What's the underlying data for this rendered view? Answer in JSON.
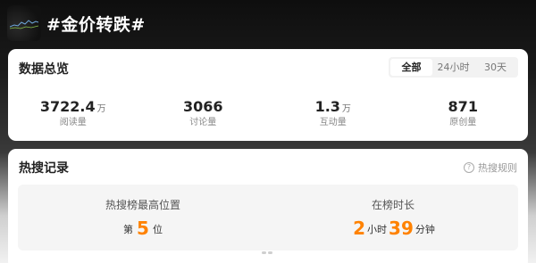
{
  "topic": {
    "title": "#金价转跌#"
  },
  "overview": {
    "title": "数据总览",
    "tabs": [
      {
        "label": "全部",
        "active": true
      },
      {
        "label": "24小时",
        "active": false
      },
      {
        "label": "30天",
        "active": false
      }
    ],
    "stats": [
      {
        "value": "3722.4",
        "unit": "万",
        "label": "阅读量"
      },
      {
        "value": "3066",
        "unit": "",
        "label": "讨论量"
      },
      {
        "value": "1.3",
        "unit": "万",
        "label": "互动量"
      },
      {
        "value": "871",
        "unit": "",
        "label": "原创量"
      }
    ]
  },
  "hot_record": {
    "title": "热搜记录",
    "rules_label": "热搜规则",
    "highest": {
      "label": "热搜榜最高位置",
      "prefix": "第",
      "value": "5",
      "suffix": "位"
    },
    "duration": {
      "label": "在榜时长",
      "hours": "2",
      "hours_unit": "小时",
      "minutes": "39",
      "minutes_unit": "分钟"
    }
  },
  "colors": {
    "accent": "#ff8200",
    "card_bg": "#ffffff",
    "panel_bg": "#f5f5f5"
  }
}
